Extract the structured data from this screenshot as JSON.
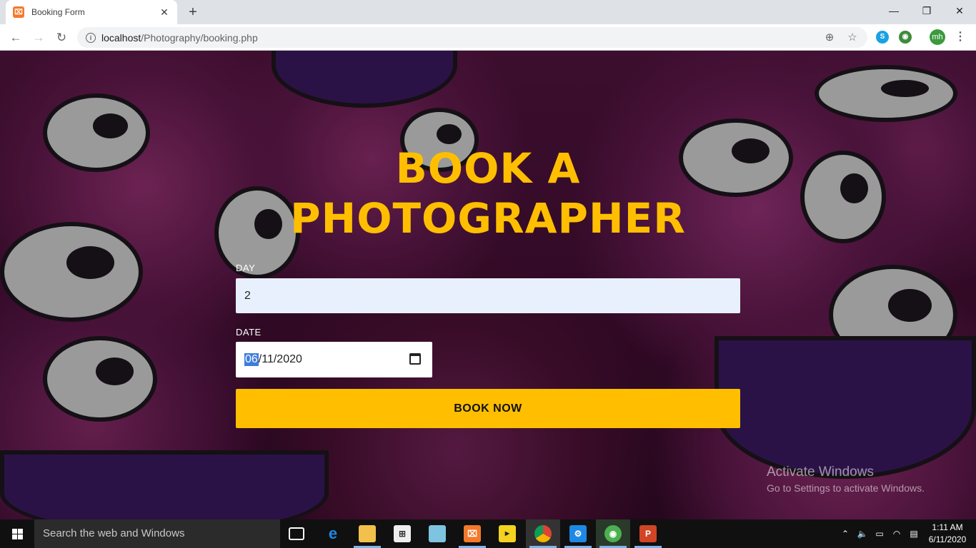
{
  "browser": {
    "tab_title": "Booking Form",
    "favicon_text": "⌧",
    "new_tab": "+",
    "url_host": "localhost",
    "url_path": "/Photography/booking.php",
    "profile_initials": "mh",
    "window_controls": {
      "minimize": "—",
      "restore": "❐",
      "close": "✕"
    },
    "nav": {
      "back": "←",
      "forward": "→",
      "reload": "↻"
    }
  },
  "page": {
    "heading_line1": "BOOK A",
    "heading_line2": "PHOTOGRAPHER",
    "day_label": "DAY",
    "day_value": "2",
    "date_label": "DATE",
    "date_month": "06",
    "date_rest": "/11/2020",
    "submit_label": "BOOK NOW",
    "colors": {
      "accent": "#ffbf00",
      "input_bg": "#e8f0fe"
    }
  },
  "watermark": {
    "title": "Activate Windows",
    "subtitle": "Go to Settings to activate Windows."
  },
  "taskbar": {
    "search_placeholder": "Search the web and Windows",
    "time": "1:11 AM",
    "date": "6/11/2020",
    "pinned": [
      "task-view-icon",
      "edge-icon",
      "file-explorer-icon",
      "store-icon",
      "paint-icon",
      "xampp-icon",
      "player-icon",
      "chrome-icon",
      "settings-icon",
      "globe-icon",
      "powerpoint-icon"
    ]
  }
}
